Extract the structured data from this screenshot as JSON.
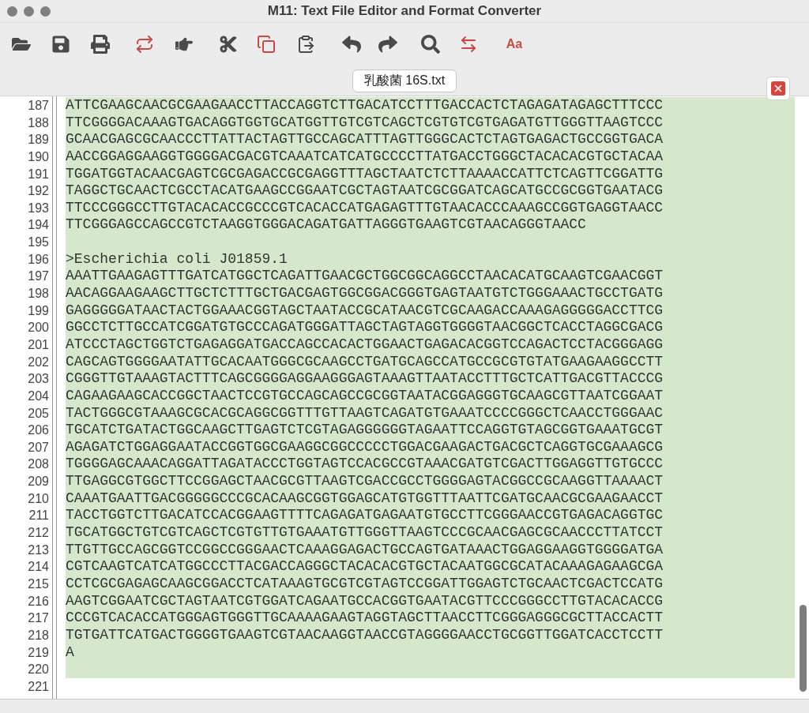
{
  "window": {
    "title": "M11: Text File Editor and Format Converter"
  },
  "toolbar": {
    "font_button": {
      "label": "Aa"
    }
  },
  "tab": {
    "label": "乳酸菌 16S.txt",
    "selected": true
  },
  "editor": {
    "lines": [
      {
        "number": "187",
        "text": "ATTCGAAGCAACGCGAAGAACCTTACCAGGTCTTGACATCCTTTGACCACTCTAGAGATAGAGCTTTCCC",
        "selected": true
      },
      {
        "number": "188",
        "text": "TTCGGGGACAAAGTGACAGGTGGTGCATGGTTGTCGTCAGCTCGTGTCGTGAGATGTTGGGTTAAGTCCC",
        "selected": true
      },
      {
        "number": "189",
        "text": "GCAACGAGCGCAACCCTTATTACTAGTTGCCAGCATTTAGTTGGGCACTCTAGTGAGACTGCCGGTGACA",
        "selected": true
      },
      {
        "number": "190",
        "text": "AACCGGAGGAAGGTGGGGACGACGTCAAATCATCATGCCCCTTATGACCTGGGCTACACACGTGCTACAA",
        "selected": true
      },
      {
        "number": "191",
        "text": "TGGATGGTACAACGAGTCGCGAGACCGCGAGGTTTAGCTAATCTCTTAAAACCATTCTCAGTTCGGATTG",
        "selected": true
      },
      {
        "number": "192",
        "text": "TAGGCTGCAACTCGCCTACATGAAGCCGGAATCGCTAGTAATCGCGGATCAGCATGCCGCGGTGAATACG",
        "selected": true
      },
      {
        "number": "193",
        "text": "TTCCCGGGCCTTGTACACACCGCCCGTCACACCATGAGAGTTTGTAACACCCAAAGCCGGTGAGGTAACC",
        "selected": true
      },
      {
        "number": "194",
        "text": "TTCGGGAGCCAGCCGTCTAAGGTGGGACAGATGATTAGGGTGAAGTCGTAACAGGGTAACC",
        "selected": true
      },
      {
        "number": "195",
        "selected": true
      },
      {
        "number": "196",
        "text": ">Escherichia coli J01859.1",
        "selected": true
      },
      {
        "number": "197",
        "text": "AAATTGAAGAGTTTGATCATGGCTCAGATTGAACGCTGGCGGCAGGCCTAACACATGCAAGTCGAACGGT",
        "selected": true
      },
      {
        "number": "198",
        "text": "AACAGGAAGAAGCTTGCTCTTTGCTGACGAGTGGCGGACGGGTGAGTAATGTCTGGGAAACTGCCTGATG",
        "selected": true
      },
      {
        "number": "199",
        "text": "GAGGGGGATAACTACTGGAAACGGTAGCTAATACCGCATAACGTCGCAAGACCAAAGAGGGGGACCTTCG",
        "selected": true
      },
      {
        "number": "200",
        "text": "GGCCTCTTGCCATCGGATGTGCCCAGATGGGATTAGCTAGTAGGTGGGGTAACGGCTCACCTAGGCGACG",
        "selected": true
      },
      {
        "number": "201",
        "text": "ATCCCTAGCTGGTCTGAGAGGATGACCAGCCACACTGGAACTGAGACACGGTCCAGACTCCTACGGGAGG",
        "selected": true
      },
      {
        "number": "202",
        "text": "CAGCAGTGGGGAATATTGCACAATGGGCGCAAGCCTGATGCAGCCATGCCGCGTGTATGAAGAAGGCCTT",
        "selected": true
      },
      {
        "number": "203",
        "text": "CGGGTTGTAAAGTACTTTCAGCGGGGAGGAAGGGAGTAAAGTTAATACCTTTGCTCATTGACGTTACCCG",
        "selected": true
      },
      {
        "number": "204",
        "text": "CAGAAGAAGCACCGGCTAACTCCGTGCCAGCAGCCGCGGTAATACGGAGGGTGCAAGCGTTAATCGGAAT",
        "selected": true
      },
      {
        "number": "205",
        "text": "TACTGGGCGTAAAGCGCACGCAGGCGGTTTGTTAAGTCAGATGTGAAATCCCCGGGCTCAACCTGGGAAC",
        "selected": true
      },
      {
        "number": "206",
        "text": "TGCATCTGATACTGGCAAGCTTGAGTCTCGTAGAGGGGGGTAGAATTCCAGGTGTAGCGGTGAAATGCGT",
        "selected": true
      },
      {
        "number": "207",
        "text": "AGAGATCTGGAGGAATACCGGTGGCGAAGGCGGCCCCCTGGACGAAGACTGACGCTCAGGTGCGAAAGCG",
        "selected": true
      },
      {
        "number": "208",
        "text": "TGGGGAGCAAACAGGATTAGATACCCTGGTAGTCCACGCCGTAAACGATGTCGACTTGGAGGTTGTGCCC",
        "selected": true
      },
      {
        "number": "209",
        "text": "TTGAGGCGTGGCTTCCGGAGCTAACGCGTTAAGTCGACCGCCTGGGGAGTACGGCCGCAAGGTTAAAACT",
        "selected": true
      },
      {
        "number": "210",
        "text": "CAAATGAATTGACGGGGGCCCGCACAAGCGGTGGAGCATGTGGTTTAATTCGATGCAACGCGAAGAACCT",
        "selected": true
      },
      {
        "number": "211",
        "text": "TACCTGGTCTTGACATCCACGGAAGTTTTCAGAGATGAGAATGTGCCTTCGGGAACCGTGAGACAGGTGC",
        "selected": true
      },
      {
        "number": "212",
        "text": "TGCATGGCTGTCGTCAGCTCGTGTTGTGAAATGTTGGGTTAAGTCCCGCAACGAGCGCAACCCTTATCCT",
        "selected": true
      },
      {
        "number": "213",
        "text": "TTGTTGCCAGCGGTCCGGCCGGGAACTCAAAGGAGACTGCCAGTGATAAACTGGAGGAAGGTGGGGATGA",
        "selected": true
      },
      {
        "number": "214",
        "text": "CGTCAAGTCATCATGGCCCTTACGACCAGGGCTACACACGTGCTACAATGGCGCATACAAAGAGAAGCGA",
        "selected": true
      },
      {
        "number": "215",
        "text": "CCTCGCGAGAGCAAGCGGACCTCATAAAGTGCGTCGTAGTCCGGATTGGAGTCTGCAACTCGACTCCATG",
        "selected": true
      },
      {
        "number": "216",
        "text": "AAGTCGGAATCGCTAGTAATCGTGGATCAGAATGCCACGGTGAATACGTTCCCGGGCCTTGTACACACCG",
        "selected": true
      },
      {
        "number": "217",
        "text": "CCCGTCACACCATGGGAGTGGGTTGCAAAAGAAGTAGGTAGCTTAACCTTCGGGAGGGCGCTTACCACTT",
        "selected": true
      },
      {
        "number": "218",
        "text": "TGTGATTCATGACTGGGGTGAAGTCGTAACAAGGTAACCGTAGGGGAACCTGCGGTTGGATCACCTCCTT",
        "selected": true
      },
      {
        "number": "219",
        "text": "A",
        "selected": true
      },
      {
        "number": "220",
        "selected": true
      },
      {
        "number": "221",
        "selected": false
      }
    ]
  }
}
